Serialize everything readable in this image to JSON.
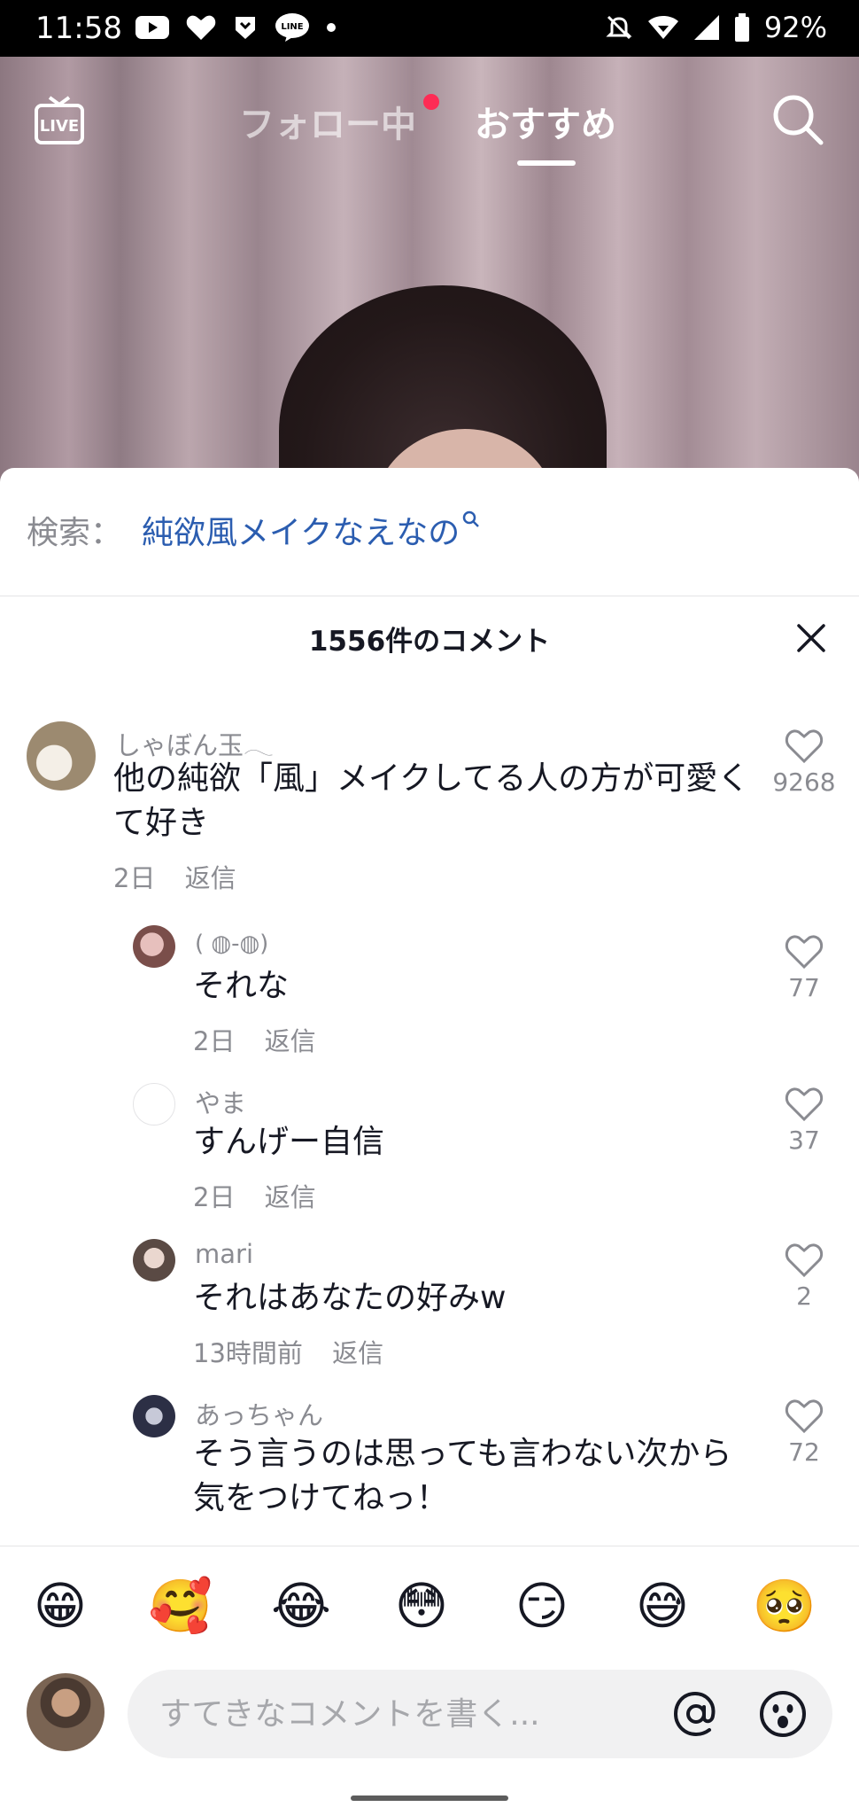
{
  "status_bar": {
    "time": "11:58",
    "battery": "92%"
  },
  "top_nav": {
    "live_label": "LIVE",
    "tab_following": "フォロー中",
    "tab_for_you": "おすすめ"
  },
  "sheet": {
    "search_prefix": "検索：",
    "search_query": "純欲風メイクなえなの",
    "comment_count_title": "1556件のコメント"
  },
  "comments": [
    {
      "user": "しゃぼん玉𓂃",
      "text": "他の純欲「風」メイクしてる人の方が可愛くて好き",
      "time": "2日",
      "reply": "返信",
      "likes": "9268"
    },
    {
      "user": "( ◍-◍)",
      "text": "それな",
      "time": "2日",
      "reply": "返信",
      "likes": "77"
    },
    {
      "user": "やま",
      "text": "すんげー自信",
      "time": "2日",
      "reply": "返信",
      "likes": "37"
    },
    {
      "user": "mari",
      "text": "それはあなたの好みw",
      "time": "13時間前",
      "reply": "返信",
      "likes": "2"
    },
    {
      "user": "あっちゃん",
      "text": "そう言うのは思っても言わない次から気をつけてねっ！",
      "likes": "72"
    }
  ],
  "emoji_bar": [
    "😁",
    "🥰",
    "😂",
    "😳",
    "😏",
    "😅",
    "🥺"
  ],
  "composer": {
    "placeholder": "すてきなコメントを書く..."
  }
}
